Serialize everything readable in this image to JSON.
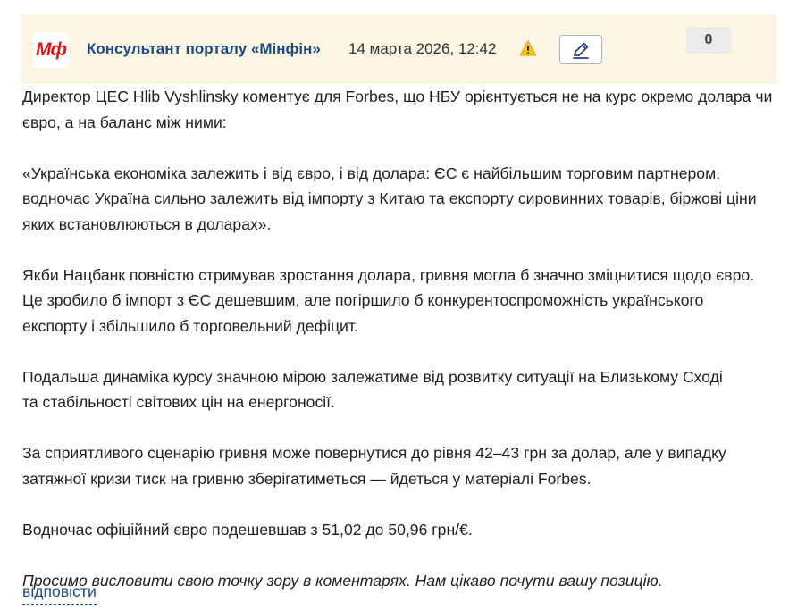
{
  "header": {
    "logo_text": "Мф",
    "author": "Консультант порталу «Мінфін»",
    "date": "14 марта 2026, 12:42",
    "counter": "0",
    "warning_icon": "warning-icon",
    "edit_icon": "pencil-icon",
    "background_color": "#fbf5e4",
    "author_color": "#1d4a86",
    "logo_color": "#d91a1a"
  },
  "body": {
    "paragraphs": [
      "Директор ЦЕС Hlib Vyshlinsky коментує для Forbes, що НБУ орієнтується не на курс окремо долара чи\nєвро, а на баланс між ними:",
      "«Українська економіка залежить і від євро, і від долара: ЄС є найбільшим торговим партнером,\nводночас Україна сильно залежить від імпорту з Китаю та експорту сировинних товарів, біржові ціни\nяких встановлюються в доларах».",
      "Якби Нацбанк повністю стримував зростання долара, гривня могла б значно зміцнитися щодо євро.\nЦе зробило б імпорт з ЄС дешевшим, але погіршило б конкурентоспроможність українського\nекспорту і збільшило б торговельний дефіцит.",
      "Подальша динаміка курсу значною мірою залежатиме від розвитку ситуації на Близькому Сході\nта стабільності світових цін на енергоносії.",
      "За сприятливого сценарію гривня може повернутися до рівня 42–43 грн за долар, але у випадку\nзатяжної кризи тиск на гривню зберігатиметься — йдеться у матеріалі Forbes.",
      "Водночас офіційний євро подешевшав з 51,02 до 50,96 грн/€."
    ],
    "question": "Просимо висловити свою точку зору в коментарях. Нам цікаво почути вашу позицію."
  },
  "actions": {
    "reply_label": "відповісти"
  }
}
